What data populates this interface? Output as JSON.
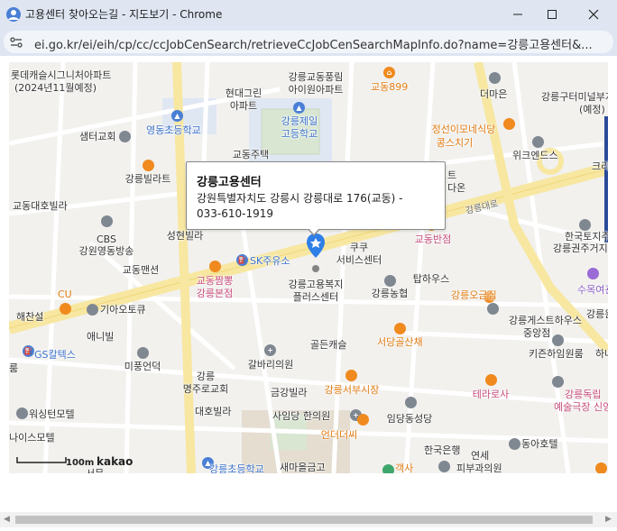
{
  "window": {
    "title": "고용센터 찾아오는길 - 지도보기 - Chrome",
    "url": "ei.go.kr/ei/eih/cp/cc/ccJobCenSearch/retrieveCcJobCenSearchMapInfo.do?name=강릉고용센터&..."
  },
  "infowindow": {
    "name": "강릉고용센터",
    "address": "강원특별자치도 강릉시 강릉대로 176(교동) -",
    "tel": "033-610-1919"
  },
  "map": {
    "scale_label": "100m",
    "provider": "kakao",
    "labels": {
      "lotte": "롯데캐슬시그니처아파트",
      "lotte_note": "(2024년11월예정)",
      "gyodong_pungrim": "강릉교동풍림",
      "iwon": "아이원아파트",
      "gyodong899": "교동899",
      "deomaeun": "더마은",
      "gangneung_guteo": "강릉구터미널부지",
      "yejeong": "(예정)",
      "hyundai_green": "현대그린",
      "apt": "아파트",
      "gangneung_jeil": "강릉제일",
      "godeung": "고등학교",
      "yeongdong_elem": "영동초등학교",
      "saemteo_church": "샘터교회",
      "jeongseon": "정선이모네식당",
      "kongsuchi": "콩스치기",
      "wik_ends": "위크엔드스",
      "kris": "크리스",
      "gyodong_jutaek": "교동주택",
      "gangneung_villa": "강릉빌라트",
      "te": "트",
      "daon": "다온",
      "gyodong_daeho": "교동대호빌라",
      "gangneungdaero": "강릉대로",
      "cbs": "CBS",
      "gangwon_yeongdong": "강원영동방송",
      "hanguk_toji": "한국토지주택",
      "gyodong_banjeom": "교동반점",
      "gangneung_gwon": "강릉권주거지",
      "seonghyeon": "성현빌라",
      "sk_oil": "SK주유소",
      "kukuk": "쿠쿠",
      "service_center": "서비스센터",
      "gyodong_maensyeon": "교동맨션",
      "gyodong_jjamppong": "교동짬뽕",
      "gangneung_bonjeom": "강릉본점",
      "welfare_plus1": "강릉고용복지",
      "welfare_plus2": "플러스센터",
      "taphouse": "탑하우스",
      "gangneung_nonghyup": "강릉농협",
      "suyeogwan": "수목여관",
      "cu": "CU",
      "haechanseol": "해찬설",
      "gia_autokyu": "기아오토큐",
      "gangneung_ogeum": "강릉오금집",
      "gangneung_guesthouse": "강릉게스트하우스",
      "jungangjeom": "중앙점",
      "gangneung_right": "강릉원",
      "aenibil": "애니빌",
      "seodang": "서당골산채",
      "golden_castle": "골든캐슬",
      "kizen": "키즌하임원룸",
      "gs_caltex": "GS칼텍스",
      "mipum_eondeok": "미풍언덕",
      "gangneung2": "강릉",
      "myeongju": "명주로교회",
      "galbari": "갈바리의원",
      "gangneung_seobu": "강릉서부시장",
      "terrace": "테라로사",
      "gangneung_dongnip": "강릉독립",
      "yesulgukjang": "예술극장 신영",
      "rum": "룸",
      "daeho_villa": "대호빌라",
      "geumgang": "금강빌라",
      "wisdom_motel": "워싱턴모텔",
      "sadangdong": "사임당 한의원",
      "imdangdong": "임당동성당",
      "naisu_motel": "나이스모텔",
      "eondeoss": "언더더씨",
      "dongah_hotel": "동아호텔",
      "hanguk_bank": "한국은행",
      "yeonse": "연세",
      "pibu": "피부과의원",
      "gangneung_elem": "강릉초등학교",
      "saemaeul": "새마을금고",
      "gaeksa": "객사",
      "seomun": "서문",
      "hanil": "하나"
    }
  },
  "scrollbar": {
    "left_arrow": "◀",
    "right_arrow": "▶"
  }
}
